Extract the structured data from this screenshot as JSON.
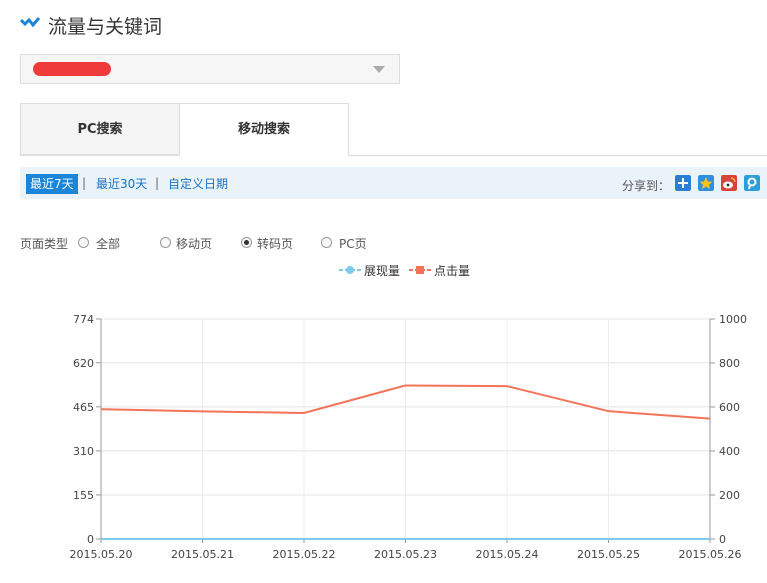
{
  "header": {
    "title": "流量与关键词",
    "icon": "chevron-check-icon"
  },
  "site_select": {
    "value": ""
  },
  "tabs": [
    {
      "label": "PC搜索",
      "active": false
    },
    {
      "label": "移动搜索",
      "active": true
    }
  ],
  "range": {
    "items": [
      "最近7天",
      "最近30天",
      "自定义日期"
    ],
    "active": "最近7天",
    "sep": "|"
  },
  "share": {
    "label": "分享到：",
    "icons": [
      "plus-share-icon",
      "qzone-icon",
      "weibo-icon",
      "tencent-weibo-icon"
    ]
  },
  "page_type": {
    "label": "页面类型",
    "options": [
      "全部",
      "移动页",
      "转码页",
      "PC页"
    ],
    "selected": "转码页"
  },
  "legend": [
    "展现量",
    "点击量"
  ],
  "colors": {
    "impressions": "#7ec9ee",
    "clicks": "#f4745a",
    "accent": "#1a85d9"
  },
  "chart_data": {
    "type": "line",
    "categories": [
      "2015.05.20",
      "2015.05.21",
      "2015.05.22",
      "2015.05.23",
      "2015.05.24",
      "2015.05.25",
      "2015.05.26"
    ],
    "series": [
      {
        "name": "展现量",
        "axis": "left",
        "values": [
          0,
          0,
          0,
          0,
          0,
          0,
          0
        ]
      },
      {
        "name": "点击量",
        "axis": "right",
        "values": [
          590,
          580,
          573,
          698,
          695,
          581,
          547
        ]
      }
    ],
    "y_left": {
      "ticks": [
        "774",
        "620",
        "465",
        "310",
        "155",
        "0"
      ],
      "ylim": [
        0,
        774
      ]
    },
    "y_right": {
      "ticks": [
        "1000",
        "800",
        "600",
        "400",
        "200",
        "0"
      ],
      "ylim": [
        0,
        1000
      ]
    },
    "grid": true,
    "legend_position": "top-center"
  }
}
